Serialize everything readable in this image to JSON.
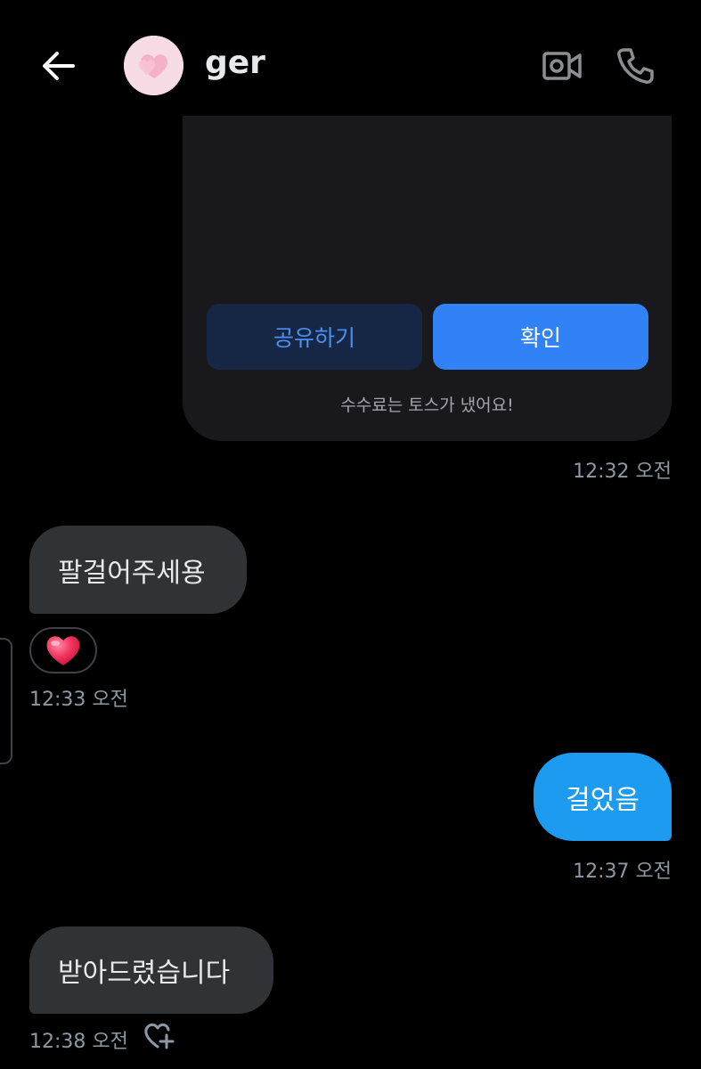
{
  "header": {
    "username": "ger",
    "back_icon": "arrow-left-icon",
    "video_icon": "video-call-icon",
    "phone_icon": "phone-icon"
  },
  "card": {
    "share_label": "공유하기",
    "confirm_label": "확인",
    "note": "수수료는 토스가 냈어요!",
    "timestamp": "12:32 오전"
  },
  "messages": [
    {
      "direction": "incoming",
      "text": "팔걸어주세용",
      "reaction": "heart",
      "timestamp": "12:33 오전"
    },
    {
      "direction": "outgoing",
      "text": "걸었음",
      "timestamp": "12:37 오전"
    },
    {
      "direction": "incoming",
      "text": "받아드렸습니다",
      "timestamp": "12:38 오전"
    }
  ],
  "colors": {
    "background": "#000000",
    "incoming_bubble": "#2f3336",
    "outgoing_bubble": "#1d9bf0",
    "card_background": "#19191d",
    "confirm_button": "#3182f6",
    "share_button": "#152744",
    "timestamp": "#8b98a5"
  }
}
